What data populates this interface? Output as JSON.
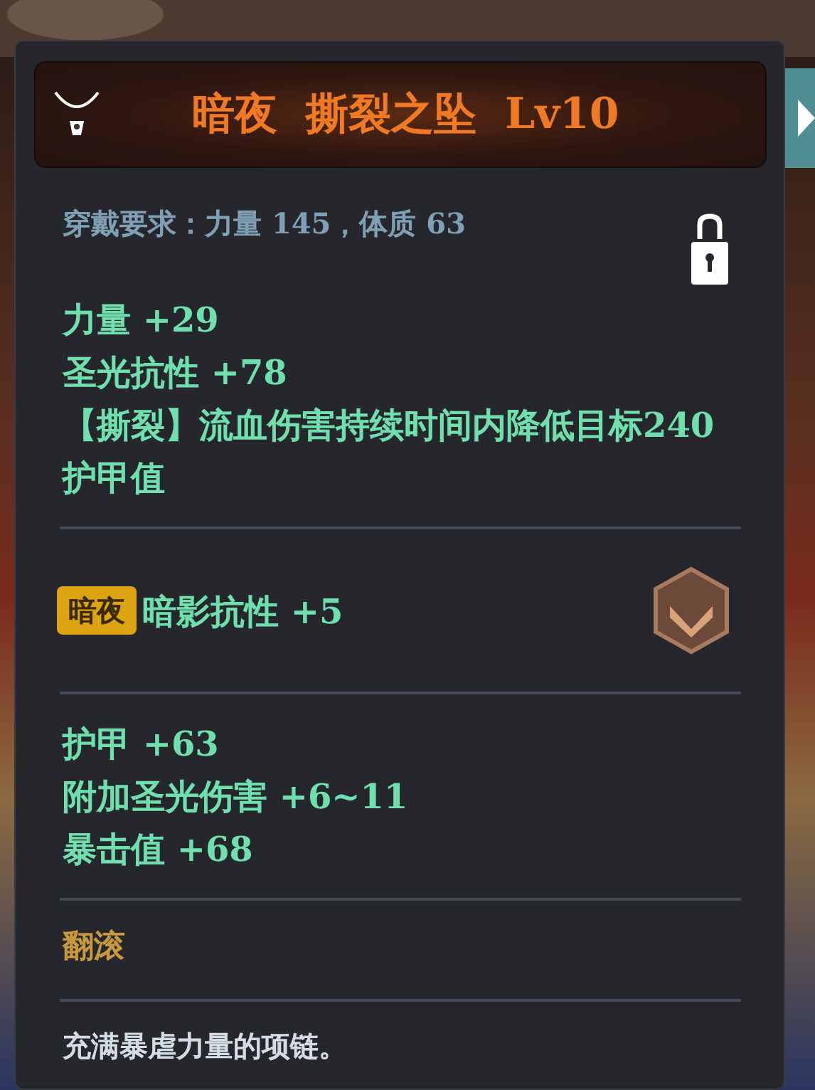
{
  "item": {
    "title": [
      "暗夜",
      "撕裂之坠",
      "Lv10"
    ]
  },
  "requirement": {
    "text": "穿戴要求：力量 145，体质 63",
    "locked": true
  },
  "base_stats": [
    "力量 +29",
    "圣光抗性 +78",
    "【撕裂】流血伤害持续时间内降低目标240护甲值"
  ],
  "set_bonus": {
    "tag": "暗夜",
    "text": "暗影抗性 +5"
  },
  "extra_stats": [
    "护甲 +63",
    "附加圣光伤害 +6~11",
    "暴击值 +68"
  ],
  "skill": "翻滚",
  "description": "充满暴虐力量的项链。"
}
